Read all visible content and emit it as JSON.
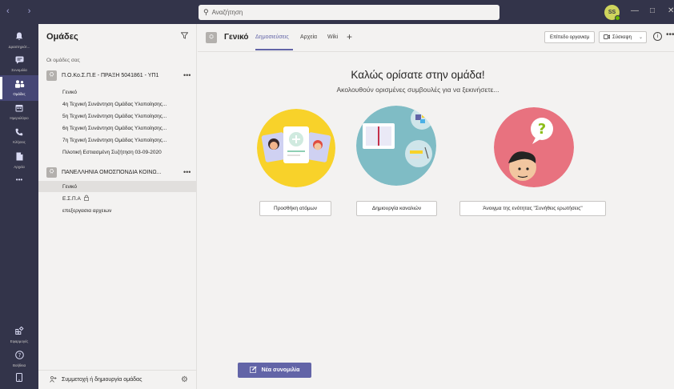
{
  "titlebar": {
    "back_glyph": "‹",
    "forward_glyph": "›",
    "search_placeholder": "Αναζήτηση",
    "avatar_initials": "SS",
    "minimize_glyph": "—",
    "maximize_glyph": "□",
    "close_glyph": "✕"
  },
  "rail": {
    "items": [
      {
        "label": "Δραστηριότ...",
        "icon": "bell-icon",
        "glyph": "🔔"
      },
      {
        "label": "Συνομιλία",
        "icon": "chat-icon",
        "glyph": "💬"
      },
      {
        "label": "Ομάδες",
        "icon": "teams-icon",
        "glyph": "👥"
      },
      {
        "label": "Ημερολόγιο",
        "icon": "calendar-icon",
        "glyph": "📅"
      },
      {
        "label": "Κλήσεις",
        "icon": "phone-icon",
        "glyph": "📞"
      },
      {
        "label": "Αρχεία",
        "icon": "file-icon",
        "glyph": "📄"
      },
      {
        "label": "",
        "icon": "more-apps-icon",
        "glyph": "•••"
      },
      {
        "label": "Εφαρμογές",
        "icon": "apps-icon",
        "glyph": "⊞"
      },
      {
        "label": "Βοήθεια",
        "icon": "help-icon",
        "glyph": "?"
      },
      {
        "label": "",
        "icon": "device-icon",
        "glyph": "▯"
      }
    ]
  },
  "panel": {
    "title": "Ομάδες",
    "filter_glyph": "∇",
    "section_label": "Οι ομάδες σας",
    "teams": [
      {
        "name": "Π.Ο.Κο.Σ.Π.Ε - ΠΡΑΞΗ 5041861 - ΥΠ1",
        "channels": [
          "Γενικό",
          "4η Τεχνική Συνάντηση Ομάδας Υλοποίησης...",
          "5η Τεχνική Συνάντηση Ομάδας Υλοποίησης...",
          "6η Τεχνική Συνάντηση Ομάδας Υλοποίησης...",
          "7η Τεχνική Συνάντηση Ομάδας Υλοποίησης...",
          "Πιλοτική Εστιασμένη Συζήτηση 03-09-2020"
        ]
      },
      {
        "name": "ΠΑΝΕΛΛΗΝΙΑ ΟΜΟΣΠΟΝΔΙΑ ΚΟΙΝΩ...",
        "channels": [
          "Γενικό",
          "Ε.Σ.Π.Α",
          "επεξεργασια αρχειων"
        ]
      }
    ],
    "more_glyph": "•••",
    "lock_glyph": "🔒",
    "footer_label": "Συμμετοχή ή δημιουργία ομάδας",
    "join_glyph": "⚭",
    "settings_glyph": "⚙"
  },
  "header": {
    "channel_name": "Γενικό",
    "tabs": [
      "Δημοσιεύσεις",
      "Αρχεία",
      "Wiki"
    ],
    "add_tab_glyph": "+",
    "team_level_label": "Επίπεδο οργανισμ",
    "meet_label": "Σύσκεψη",
    "meet_glyph": "📹",
    "chevron_glyph": "⌄",
    "info_glyph": "i",
    "more_glyph": "•••"
  },
  "main": {
    "welcome_title": "Καλώς ορίσατε στην ομάδα!",
    "welcome_subtitle": "Ακολουθούν ορισμένες συμβουλές για να ξεκινήσετε...",
    "actions": [
      "Προσθήκη ατόμων",
      "Δημιουργία καναλιών",
      "Άνοιγμα της ενότητας \"Συνήθεις ερωτήσεις\""
    ],
    "new_conversation_label": "Νέα συνομιλία",
    "new_conversation_glyph": "✎"
  },
  "colors": {
    "rail_bg": "#33344a",
    "accent": "#6264a7",
    "circle_yellow": "#f8d22a",
    "circle_teal": "#7fbcc5",
    "circle_pink": "#e8727f"
  }
}
